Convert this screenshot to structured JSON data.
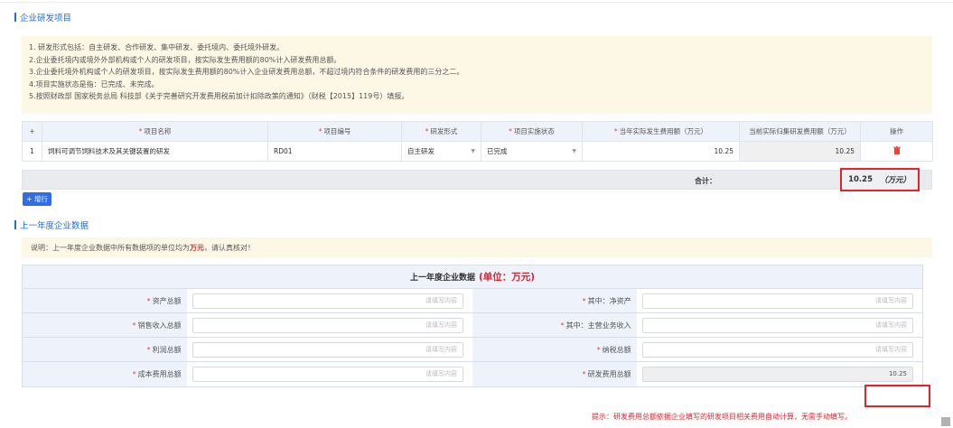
{
  "rd_projects": {
    "title": "企业研发项目",
    "notes": [
      "1. 研发形式包括：自主研发、合作研发、集中研发、委托境内、委托境外研发。",
      "2.企业委托境内或境外外部机构或个人的研发项目，按实际发生费用额的80%计入研发费用总额。",
      "3.企业委托境外机构或个人的研发项目，按实际发生费用额的80%计入企业研发费用总额，不超过境内符合条件的研发费用的三分之二。",
      "4.项目实施状态是指：已完成、未完成。",
      "5.按照财政部 国家税务总局 科技部《关于完善研究开发费用税前加计扣除政策的通知》（财税【2015】119号）填报。"
    ],
    "columns": {
      "add": "+",
      "name": "项目名称",
      "code": "项目编号",
      "form": "研发形式",
      "status": "项目实施状态",
      "amount": "当年实际发生费用额（万元）",
      "collected": "当前实际归集研发费用额（万元）",
      "action": "操作"
    },
    "rows": [
      {
        "index": "1",
        "name": "饲料可调节饲料技术及其关键装置的研发",
        "code": "RD01",
        "form": "自主研发",
        "status": "已完成",
        "amount": "10.25",
        "collected": "10.25",
        "delete_icon": "trash-icon"
      }
    ],
    "total_label": "合计：",
    "total_value": "10.25",
    "total_unit": "（万元）",
    "add_row_label": "+ 增行"
  },
  "prev_year": {
    "title": "上一年度企业数据",
    "note_prefix": "说明：上一年度企业数据中所有数据项的单位均为",
    "note_unit": "万元",
    "note_suffix": "，请认真核对！",
    "table_title": "上一年度企业数据",
    "table_unit": "(单位：万元)",
    "placeholder": "请填写内容",
    "fields": {
      "total_assets": "资产总额",
      "net_assets": "其中：净资产",
      "sales_revenue": "销售收入总额",
      "main_revenue": "其中：主营业务收入",
      "total_profit": "利润总额",
      "total_tax": "纳税总额",
      "total_cost": "成本费用总额",
      "rd_total": "研发费用总额"
    },
    "rd_total_value": "10.25",
    "hint": "提示：研发费用总额依据企业填写的研发项目相关费用自动计算，无需手动填写。"
  },
  "colors": {
    "accent": "#1e6fd9",
    "alert": "#e3242b",
    "button": "#2f6ee8"
  }
}
